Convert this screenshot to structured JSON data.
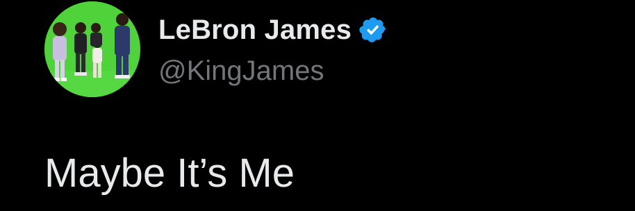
{
  "author": {
    "display_name": "LeBron James",
    "handle": "@KingJames",
    "verified": true,
    "verified_icon": "verified-badge-icon",
    "avatar": "profile-photo"
  },
  "tweet": {
    "text": "Maybe It’s Me"
  },
  "colors": {
    "background": "#000000",
    "name": "#e7e9ea",
    "handle": "#71767b",
    "verified_blue": "#1d9bf0",
    "avatar_green": "#4fd23a"
  }
}
